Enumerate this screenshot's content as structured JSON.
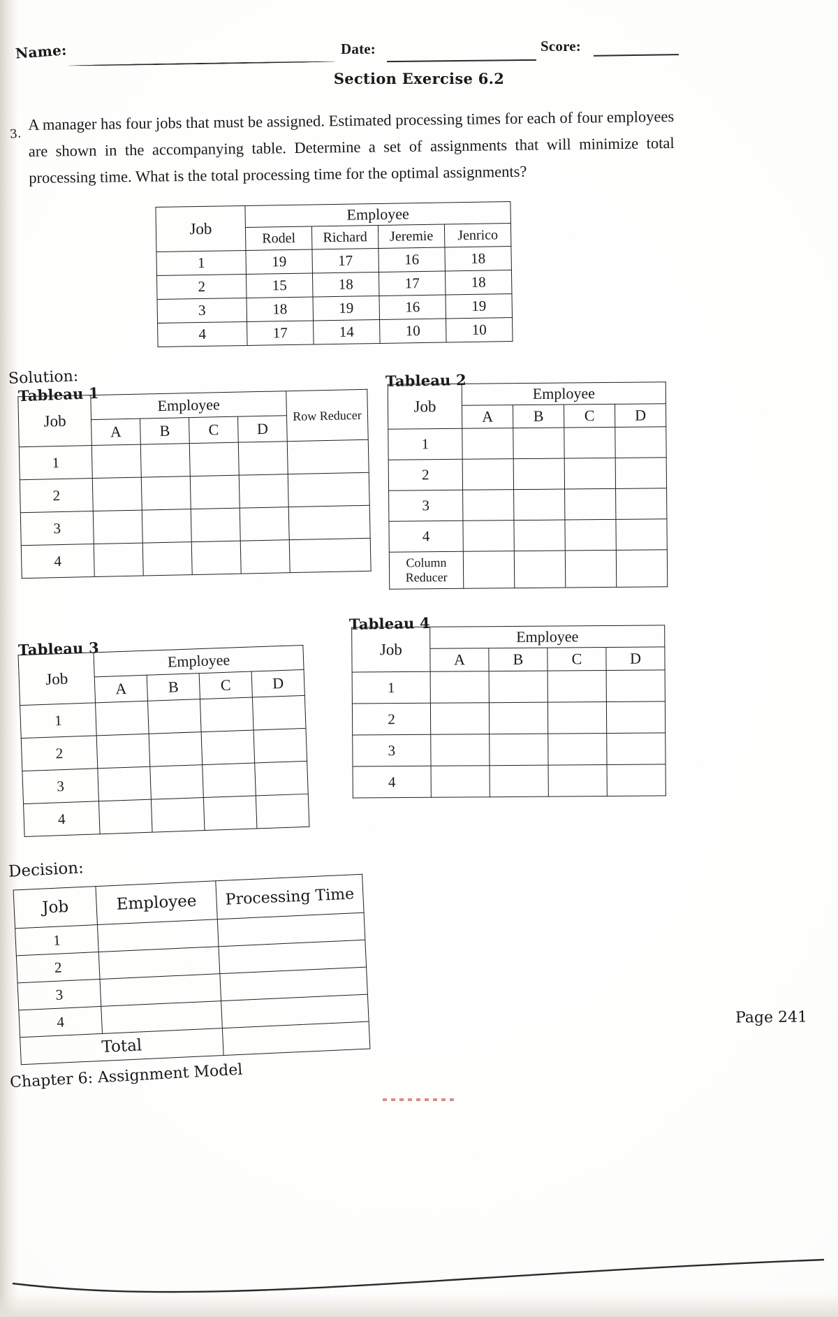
{
  "header": {
    "name_label": "Name:",
    "date_label": "Date:",
    "score_label": "Score:",
    "section_title": "Section Exercise 6.2"
  },
  "question": {
    "number": "3.",
    "text": "A manager has four jobs that must be assigned. Estimated processing times for each of four employees are shown in the accompanying table. Determine a set of assignments that will minimize total processing time. What is the total processing time for the optimal assignments?"
  },
  "problem_table": {
    "job_header": "Job",
    "group_header": "Employee",
    "employees": [
      "Rodel",
      "Richard",
      "Jeremie",
      "Jenrico"
    ],
    "rows": [
      {
        "job": "1",
        "values": [
          "19",
          "17",
          "16",
          "18"
        ]
      },
      {
        "job": "2",
        "values": [
          "15",
          "18",
          "17",
          "18"
        ]
      },
      {
        "job": "3",
        "values": [
          "18",
          "19",
          "16",
          "19"
        ]
      },
      {
        "job": "4",
        "values": [
          "17",
          "14",
          "10",
          "10"
        ]
      }
    ]
  },
  "solution": {
    "label": "Solution:",
    "tableau1": {
      "label": "Tableau 1",
      "job_header": "Job",
      "group_header": "Employee",
      "columns": [
        "A",
        "B",
        "C",
        "D"
      ],
      "row_reducer_header": "Row Reducer",
      "rows": [
        "1",
        "2",
        "3",
        "4"
      ]
    },
    "tableau2": {
      "label": "Tableau 2",
      "job_header": "Job",
      "group_header": "Employee",
      "columns": [
        "A",
        "B",
        "C",
        "D"
      ],
      "rows": [
        "1",
        "2",
        "3",
        "4"
      ],
      "column_reducer_header": "Column Reducer"
    },
    "tableau3": {
      "label": "Tableau 3",
      "job_header": "Job",
      "group_header": "Employee",
      "columns": [
        "A",
        "B",
        "C",
        "D"
      ],
      "rows": [
        "1",
        "2",
        "3",
        "4"
      ]
    },
    "tableau4": {
      "label": "Tableau 4",
      "job_header": "Job",
      "group_header": "Employee",
      "columns": [
        "A",
        "B",
        "C",
        "D"
      ],
      "rows": [
        "1",
        "2",
        "3",
        "4"
      ]
    }
  },
  "decision": {
    "label": "Decision:",
    "columns": [
      "Job",
      "Employee",
      "Processing Time"
    ],
    "rows": [
      "1",
      "2",
      "3",
      "4"
    ],
    "total_label": "Total"
  },
  "footer": {
    "page": "Page 241",
    "chapter": "Chapter 6: Assignment Model"
  }
}
